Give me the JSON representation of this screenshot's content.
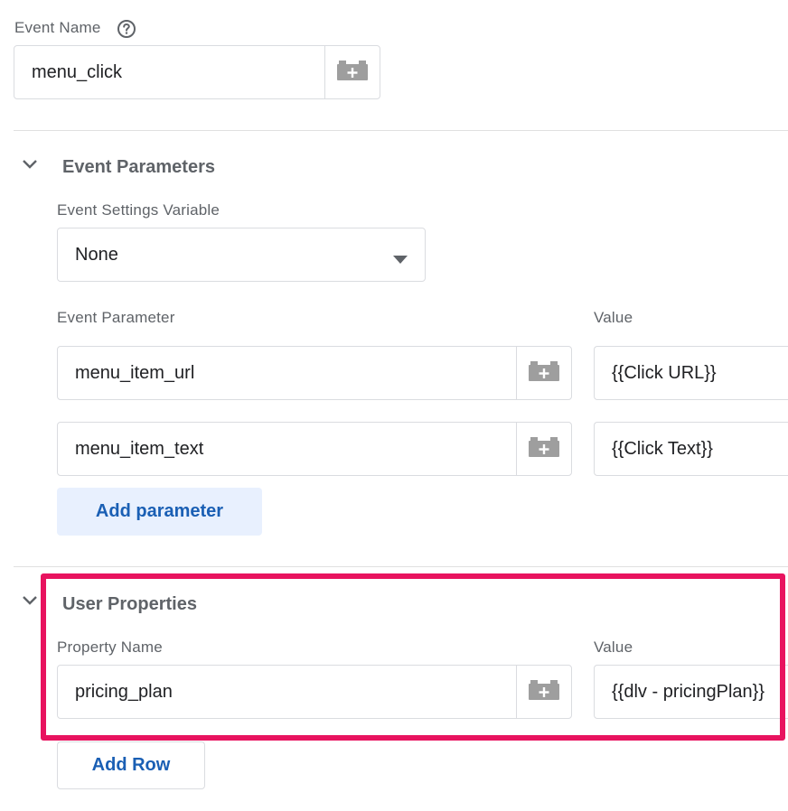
{
  "event_name": {
    "label": "Event Name",
    "help_icon": "help-circle-icon",
    "value": "menu_click",
    "variable_icon": "variable-picker-icon"
  },
  "event_parameters": {
    "title": "Event Parameters",
    "settings_variable_label": "Event Settings Variable",
    "settings_variable_value": "None",
    "parameter_col_label": "Event Parameter",
    "value_col_label": "Value",
    "rows": [
      {
        "name": "menu_item_url",
        "value": "{{Click URL}}"
      },
      {
        "name": "menu_item_text",
        "value": "{{Click Text}}"
      }
    ],
    "add_button": "Add parameter"
  },
  "user_properties": {
    "title": "User Properties",
    "property_col_label": "Property Name",
    "value_col_label": "Value",
    "rows": [
      {
        "name": "pricing_plan",
        "value": "{{dlv - pricingPlan}}"
      }
    ],
    "add_button": "Add Row",
    "highlight_color": "#e8135f"
  },
  "colors": {
    "accent_text": "#1a5fb4",
    "tonal_button_bg": "#e8f0fe",
    "border": "#dadce0",
    "label": "#5f6368"
  }
}
